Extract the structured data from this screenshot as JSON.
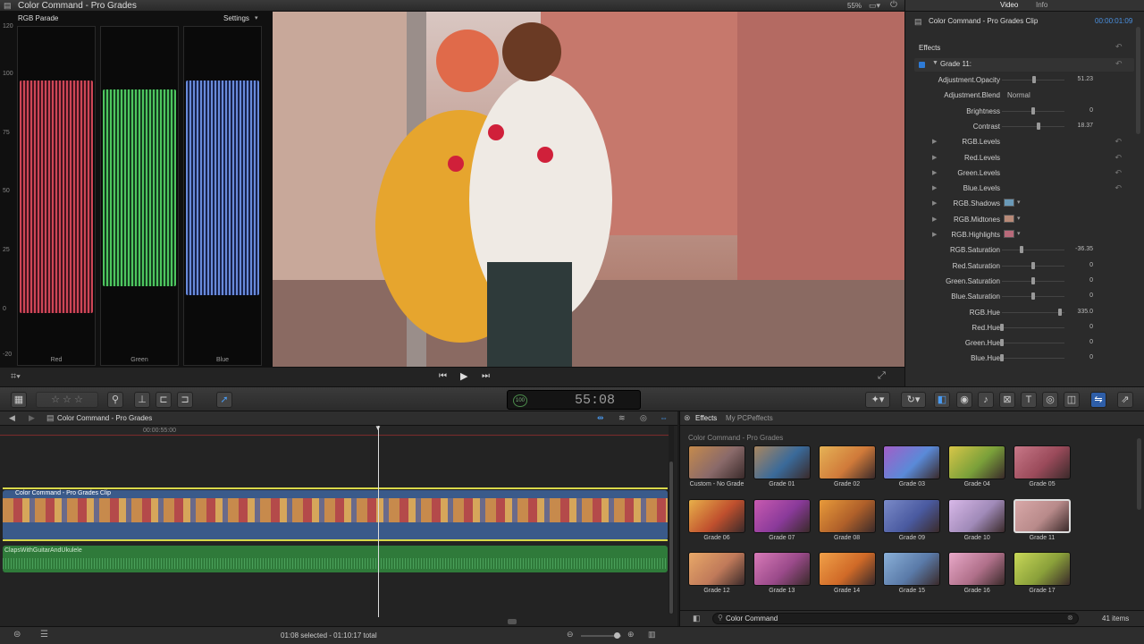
{
  "window": {
    "title": "Color Command - Pro Grades",
    "zoom": "55%",
    "tabs": [
      "Video",
      "Info"
    ]
  },
  "scopes": {
    "title": "RGB Parade",
    "settings": "Settings",
    "ticks": [
      "120",
      "100",
      "75",
      "50",
      "25",
      "0",
      "-20"
    ],
    "channels": [
      "Red",
      "Green",
      "Blue"
    ]
  },
  "inspector": {
    "clip_name": "Color Command - Pro Grades Clip",
    "timecode": "00:00:01:09",
    "section": "Effects",
    "grade": "Grade 11:",
    "params": [
      {
        "label": "Adjustment.Opacity",
        "value": "51.23",
        "type": "slider",
        "level": 0.51
      },
      {
        "label": "Adjustment.Blend",
        "value": "Normal",
        "type": "popup"
      },
      {
        "label": "Brightness",
        "value": "0",
        "type": "slider",
        "level": 0.5
      },
      {
        "label": "Contrast",
        "value": "18.37",
        "type": "slider",
        "level": 0.58
      },
      {
        "label": "RGB.Levels",
        "value": "",
        "type": "group"
      },
      {
        "label": "Red.Levels",
        "value": "",
        "type": "group"
      },
      {
        "label": "Green.Levels",
        "value": "",
        "type": "group"
      },
      {
        "label": "Blue.Levels",
        "value": "",
        "type": "group"
      },
      {
        "label": "RGB.Shadows",
        "value": "",
        "type": "color",
        "color": "#6a9ab8"
      },
      {
        "label": "RGB.Midtones",
        "value": "",
        "type": "color",
        "color": "#b88a78"
      },
      {
        "label": "RGB.Highlights",
        "value": "",
        "type": "color",
        "color": "#b86a7a"
      },
      {
        "label": "RGB.Saturation",
        "value": "-36.35",
        "type": "slider",
        "level": 0.32
      },
      {
        "label": "Red.Saturation",
        "value": "0",
        "type": "slider",
        "level": 0.5
      },
      {
        "label": "Green.Saturation",
        "value": "0",
        "type": "slider",
        "level": 0.5
      },
      {
        "label": "Blue.Saturation",
        "value": "0",
        "type": "slider",
        "level": 0.5
      },
      {
        "label": "RGB.Hue",
        "value": "335.0",
        "type": "slider",
        "level": 0.93
      },
      {
        "label": "Red.Hue",
        "value": "0",
        "type": "slider",
        "level": 0.0
      },
      {
        "label": "Green.Hue",
        "value": "0",
        "type": "slider",
        "level": 0.0
      },
      {
        "label": "Blue.Hue",
        "value": "0",
        "type": "slider",
        "level": 0.0
      }
    ]
  },
  "toolbar": {
    "timecode": "55:08",
    "timecode_badge": "100"
  },
  "timeline": {
    "project": "Color Command - Pro Grades",
    "ruler_time": "00:00:55:00",
    "video_clip": "Color Command - Pro Grades Clip",
    "audio_clip": "ClapsWithGuitarAndUkulele"
  },
  "effects": {
    "tab_effects": "Effects",
    "tab_library": "My PCPeffects",
    "category": "Color Command - Pro Grades",
    "items": [
      {
        "label": "Custom - No Grade",
        "c1": "#c58a4c",
        "c2": "#8a6a6a"
      },
      {
        "label": "Grade 01",
        "c1": "#a98660",
        "c2": "#3a6a9a"
      },
      {
        "label": "Grade 02",
        "c1": "#e5b256",
        "c2": "#d07a3a"
      },
      {
        "label": "Grade 03",
        "c1": "#a25ec8",
        "c2": "#5a8ad8"
      },
      {
        "label": "Grade 04",
        "c1": "#d8c648",
        "c2": "#7aa03a"
      },
      {
        "label": "Grade 05",
        "c1": "#c87888",
        "c2": "#9a4a5a"
      },
      {
        "label": "Grade 06",
        "c1": "#e8b04a",
        "c2": "#c0502e"
      },
      {
        "label": "Grade 07",
        "c1": "#c85ab0",
        "c2": "#8a3a9a"
      },
      {
        "label": "Grade 08",
        "c1": "#e89a3a",
        "c2": "#b0602a"
      },
      {
        "label": "Grade 09",
        "c1": "#7a8ac8",
        "c2": "#4a5aa0"
      },
      {
        "label": "Grade 10",
        "c1": "#d8b8e8",
        "c2": "#a08ab8"
      },
      {
        "label": "Grade 11",
        "c1": "#d8a8a8",
        "c2": "#b88a8a"
      },
      {
        "label": "Grade 12",
        "c1": "#e8a868",
        "c2": "#c07a5a"
      },
      {
        "label": "Grade 13",
        "c1": "#d87ab8",
        "c2": "#9a4a8a"
      },
      {
        "label": "Grade 14",
        "c1": "#f0a048",
        "c2": "#d06a28"
      },
      {
        "label": "Grade 15",
        "c1": "#8ab0d8",
        "c2": "#5a7aa8"
      },
      {
        "label": "Grade 16",
        "c1": "#e8a8c8",
        "c2": "#b0708a"
      },
      {
        "label": "Grade 17",
        "c1": "#c8d858",
        "c2": "#8aa03a"
      }
    ],
    "search_value": "Color Command",
    "count": "41 items"
  },
  "status": {
    "selection": "01:08 selected - 01:10:17 total"
  },
  "colors": {
    "accent": "#2e7bd6",
    "video_clip": "#3a5a8a",
    "audio_clip": "#2f7a3a",
    "playhead": "#dddddd"
  }
}
